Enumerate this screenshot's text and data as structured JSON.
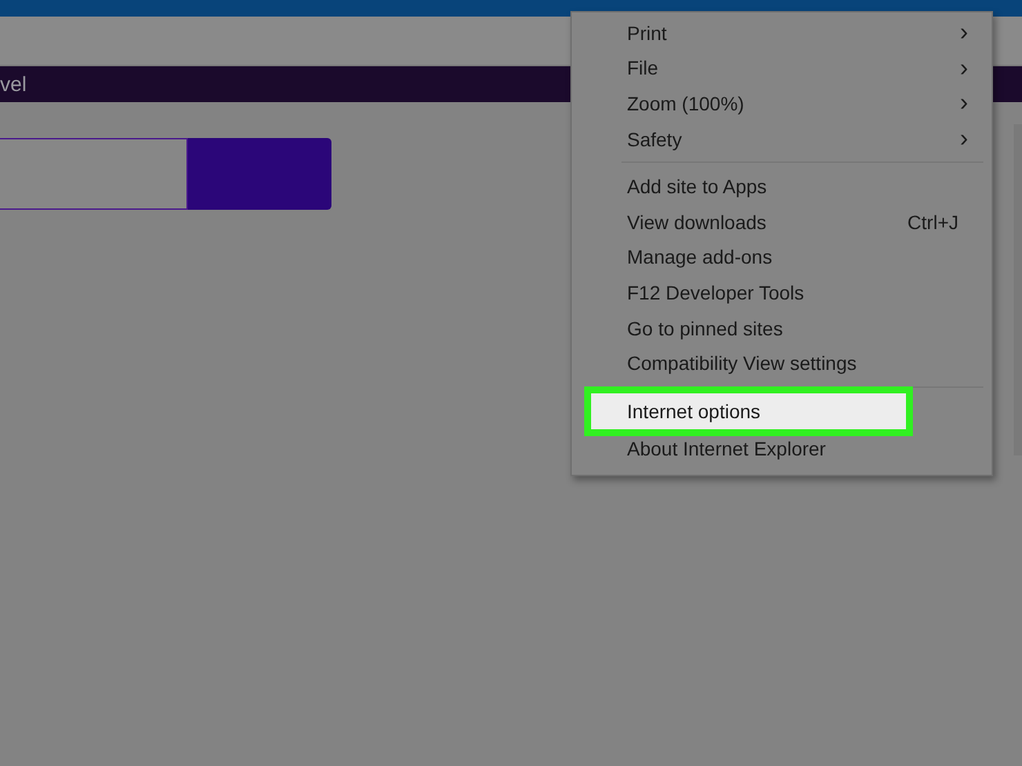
{
  "page": {
    "banner_text": "vel"
  },
  "menu": {
    "groups": [
      [
        {
          "label": "Print",
          "arrow": "›",
          "selected": false
        },
        {
          "label": "File",
          "arrow": "›",
          "selected": false
        },
        {
          "label": "Zoom (100%)",
          "arrow": "›",
          "selected": false
        },
        {
          "label": "Safety",
          "arrow": "›",
          "selected": false
        }
      ],
      [
        {
          "label": "Add site to Apps",
          "selected": false
        },
        {
          "label": "View downloads",
          "shortcut": "Ctrl+J",
          "selected": false
        },
        {
          "label": "Manage add-ons",
          "selected": false
        },
        {
          "label": "F12 Developer Tools",
          "selected": false
        },
        {
          "label": "Go to pinned sites",
          "selected": false
        },
        {
          "label": "Compatibility View settings",
          "selected": false
        }
      ],
      [
        {
          "label": "Internet options",
          "selected": true
        },
        {
          "label": "About Internet Explorer",
          "selected": false
        }
      ]
    ]
  }
}
